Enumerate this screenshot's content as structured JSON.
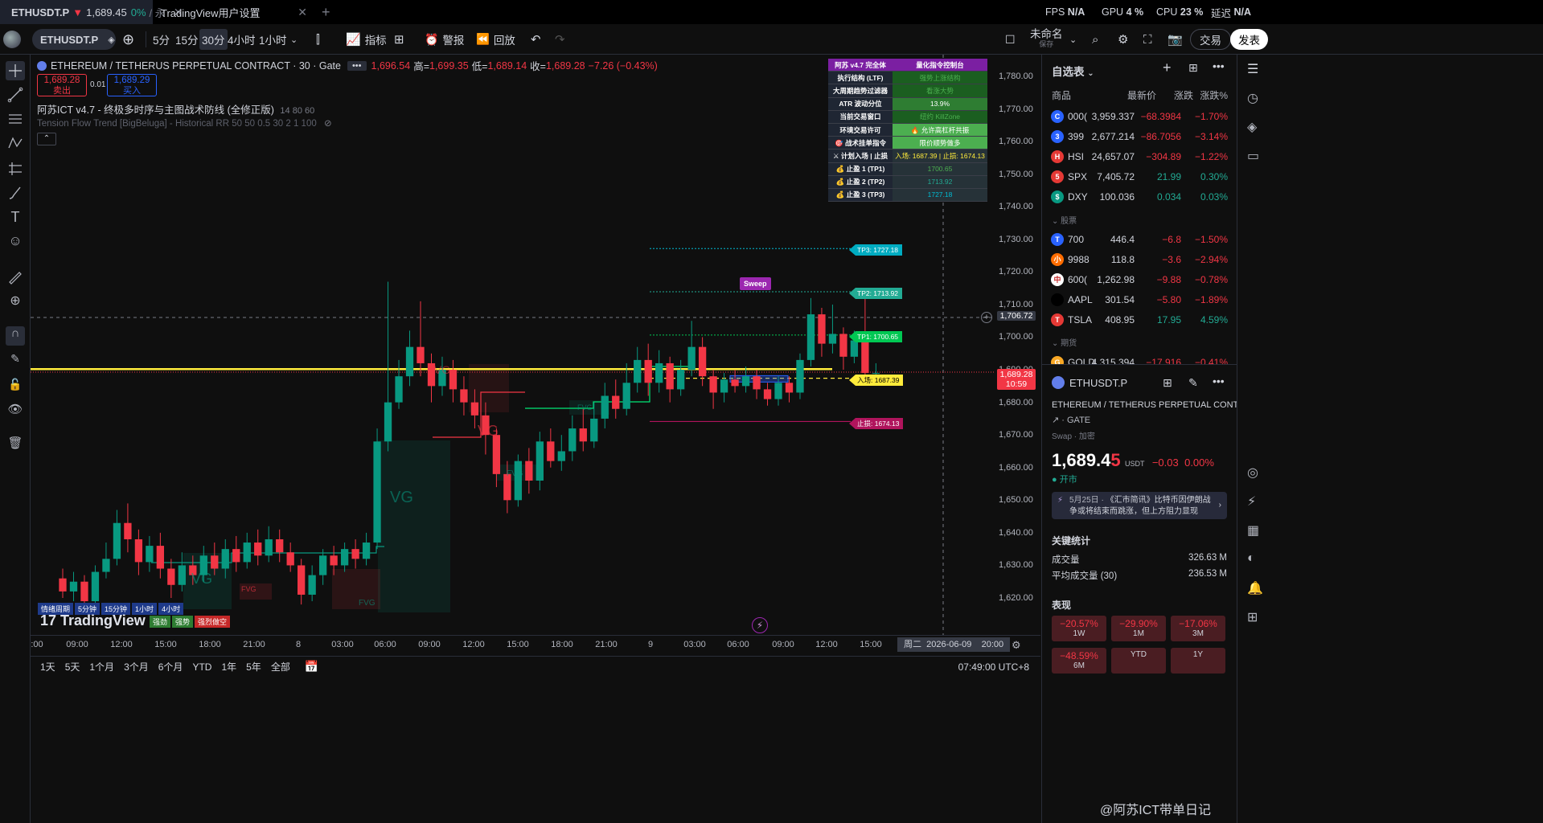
{
  "tabs": {
    "tab1_symbol": "ETHUSDT.P",
    "tab1_price": "1,689.45",
    "tab1_change": "0%",
    "tab1_extra": "/ 永",
    "tab2_title": "TradingView用户设置"
  },
  "sysinfo": {
    "fps_label": "FPS",
    "fps_value": "N/A",
    "gpu_label": "GPU",
    "gpu_value": "4 %",
    "cpu_label": "CPU",
    "cpu_value": "23 %",
    "delay_label": "延迟",
    "delay_value": "N/A"
  },
  "toolbar": {
    "symbol": "ETHUSDT.P",
    "intervals": [
      "5分",
      "15分",
      "30分",
      "4小时",
      "1小时"
    ],
    "active_interval": "30分",
    "indicators": "指标",
    "alert": "警报",
    "replay": "回放",
    "layout_name": "未命名",
    "layout_save": "保存",
    "trade": "交易",
    "publish": "发表"
  },
  "legend": {
    "title": "ETHEREUM / TETHERUS PERPETUAL CONTRACT · 30 · Gate",
    "open_val": "1,696.54",
    "high_label": "高=",
    "high_val": "1,699.35",
    "low_label": "低=",
    "low_val": "1,689.14",
    "close_label": "收=",
    "close_val": "1,689.28",
    "change": "−7.26 (−0.43%)",
    "sell_price": "1,689.28",
    "sell_label": "卖出",
    "spread": "0.01",
    "buy_price": "1,689.29",
    "buy_label": "买入",
    "ind1_name": "阿苏ICT v4.7 - 终极多时序与主图战术防线 (全修正版)",
    "ind1_params": "14 80 60",
    "ind2": "Tension Flow Trend [BigBeluga] - Historical RR 50 50 0.5 30 2 1 100"
  },
  "ict_panel": {
    "header_left": "阿苏 v4.7 完全体",
    "header_right": "量化指令控制台",
    "rows": [
      {
        "label": "执行结构 (LTF)",
        "value": "强势上涨结构"
      },
      {
        "label": "大周期趋势过滤器",
        "value": "看涨大势"
      },
      {
        "label": "ATR 波动分位",
        "value": "13.9%"
      },
      {
        "label": "当前交易窗口",
        "value": "纽约 KillZone"
      },
      {
        "label": "环境交易许可",
        "value": "🔥 允许高杠杆共振"
      },
      {
        "label": "🎯 战术挂单指令",
        "value": "限价顺势做多"
      },
      {
        "label": "⚔ 计划入场 | 止损",
        "value": "入场: 1687.39 | 止损: 1674.13"
      },
      {
        "label": "💰 止盈 1 (TP1)",
        "value": "1700.65"
      },
      {
        "label": "💰 止盈 2 (TP2)",
        "value": "1713.92"
      },
      {
        "label": "💰 止盈 3 (TP3)",
        "value": "1727.18"
      }
    ]
  },
  "levels": {
    "tp3": "TP3: 1727.18",
    "tp2": "TP2: 1713.92",
    "tp1": "TP1: 1700.65",
    "entry": "入场: 1687.39",
    "stop": "止损: 1674.13",
    "sweep": "Sweep"
  },
  "fvg_labels": [
    "VG",
    "VG",
    "VG",
    "VG",
    "FVG",
    "FVG",
    "FVG",
    "FVG"
  ],
  "mtf_bar": {
    "items": [
      "情绪周期",
      "5分钟",
      "15分钟",
      "1小时",
      "4小时"
    ],
    "row2": [
      "强劲",
      "强势",
      "强烈做空"
    ]
  },
  "watermark": "TradingView",
  "yaxis": {
    "ticks": [
      "1,780.00",
      "1,770.00",
      "1,760.00",
      "1,750.00",
      "1,740.00",
      "1,730.00",
      "1,720.00",
      "1,710.00",
      "1,700.00",
      "1,690.00",
      "1,680.00",
      "1,670.00",
      "1,660.00",
      "1,650.00",
      "1,640.00",
      "1,630.00",
      "1,620.00"
    ],
    "crosshair": "1,706.72",
    "last_price": "1,689.28",
    "countdown": "10:59"
  },
  "xaxis": {
    "ticks": [
      ":00",
      "09:00",
      "12:00",
      "15:00",
      "18:00",
      "21:00",
      "8",
      "03:00",
      "06:00",
      "09:00",
      "12:00",
      "15:00",
      "18:00",
      "21:00",
      "9",
      "03:00",
      "06:00",
      "09:00",
      "12:00",
      "15:00"
    ],
    "crosshair_date": "周二  2026-06-09    20:00"
  },
  "bottom": {
    "ranges": [
      "1天",
      "5天",
      "1个月",
      "3个月",
      "6个月",
      "YTD",
      "1年",
      "5年",
      "全部"
    ],
    "time": "07:49:00 UTC+8"
  },
  "watchlist": {
    "title": "自选表",
    "col_symbol": "商品",
    "col_last": "最新价",
    "col_change": "涨跌",
    "col_pct": "涨跌%",
    "section_stocks": "股票",
    "section_futures": "期货",
    "rows": [
      {
        "logo": "C",
        "logo_color": "#2962ff",
        "symbol": "000(",
        "last": "3,959.337",
        "change": "−68.3984",
        "pct": "−1.70%",
        "dir": "down"
      },
      {
        "logo": "3",
        "logo_color": "#2962ff",
        "symbol": "399",
        "last": "2,677.214",
        "change": "−86.7056",
        "pct": "−3.14%",
        "dir": "down"
      },
      {
        "logo": "H",
        "logo_color": "#e53935",
        "symbol": "HSI",
        "last": "24,657.07",
        "change": "−304.89",
        "pct": "−1.22%",
        "dir": "down"
      },
      {
        "logo": "5",
        "logo_color": "#e53935",
        "symbol": "SPX",
        "last": "7,405.72",
        "change": "21.99",
        "pct": "0.30%",
        "dir": "up"
      },
      {
        "logo": "$",
        "logo_color": "#089981",
        "symbol": "DXY",
        "last": "100.036",
        "change": "0.034",
        "pct": "0.03%",
        "dir": "up"
      },
      {
        "logo": "T",
        "logo_color": "#2962ff",
        "symbol": "700",
        "last": "446.4",
        "change": "−6.8",
        "pct": "−1.50%",
        "dir": "down"
      },
      {
        "logo": "小",
        "logo_color": "#ff6d00",
        "symbol": "9988",
        "last": "118.8",
        "change": "−3.6",
        "pct": "−2.94%",
        "dir": "down"
      },
      {
        "logo": "中",
        "logo_color": "#fff",
        "symbol": "600(",
        "last": "1,262.98",
        "change": "−9.88",
        "pct": "−0.78%",
        "dir": "down"
      },
      {
        "logo": "",
        "logo_color": "#000",
        "symbol": "AAPL",
        "last": "301.54",
        "change": "−5.80",
        "pct": "−1.89%",
        "dir": "down"
      },
      {
        "logo": "T",
        "logo_color": "#e53935",
        "symbol": "TSLA",
        "last": "408.95",
        "change": "17.95",
        "pct": "4.59%",
        "dir": "up"
      },
      {
        "logo": "G",
        "logo_color": "#f9a825",
        "symbol": "GOLD",
        "last": "4,315.394",
        "change": "−17.916",
        "pct": "−0.41%",
        "dir": "down"
      }
    ]
  },
  "detail": {
    "symbol": "ETHUSDT.P",
    "name": "ETHEREUM / TETHERUS PERPETUAL CONTRACT",
    "exchange": "GATE",
    "type": "Swap · 加密",
    "price_main": "1,689.4",
    "price_last_digit": "5",
    "currency": "USDT",
    "change": "−0.03",
    "pct": "0.00%",
    "market_status": "开市",
    "news_date": "5月25日 ·",
    "news_text": "《汇市简讯》比特币因伊朗战争或将结束而跳涨，但上方阻力显现",
    "stats_title": "关键统计",
    "vol_label": "成交量",
    "vol_value": "326.63 M",
    "avgvol_label": "平均成交量 (30)",
    "avgvol_value": "236.53 M",
    "perf_title": "表现",
    "perf": [
      {
        "v": "−20.57%",
        "p": "1W"
      },
      {
        "v": "−29.90%",
        "p": "1M"
      },
      {
        "v": "−17.06%",
        "p": "3M"
      },
      {
        "v": "−48.59%",
        "p": "6M"
      },
      {
        "v": "",
        "p": "YTD"
      },
      {
        "v": "",
        "p": "1Y"
      }
    ],
    "watermark2": "@阿苏ICT带单日记"
  },
  "colors": {
    "bull": "#089981",
    "bear": "#f23645",
    "yellow": "#ffeb3b",
    "tp": "#22ab94",
    "tp3": "#00bcd4",
    "stop": "#b0145c",
    "panel_green": "#4caf50"
  }
}
